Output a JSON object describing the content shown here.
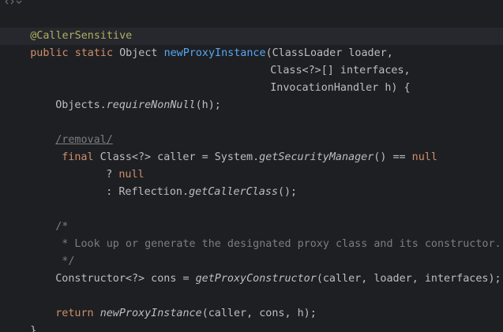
{
  "code": {
    "l1": {
      "annotation": "@CallerSensitive"
    },
    "l2": {
      "public": "public",
      "static": "static",
      "type": "Object",
      "method": "newProxyInstance",
      "params": "(ClassLoader loader,"
    },
    "l3": {
      "text": "Class<?>[] interfaces,"
    },
    "l4": {
      "text": "InvocationHandler h) {"
    },
    "l5": {
      "pre": "Objects.",
      "call": "requireNonNull",
      "post": "(h);"
    },
    "l6": {
      "marker": "/removal/"
    },
    "l7": {
      "final": "final",
      "mid": " Class<?> caller = System.",
      "call": "getSecurityManager",
      "mid2": "() == ",
      "null": "null"
    },
    "l8": {
      "q": "? ",
      "null": "null"
    },
    "l9": {
      "pre": ": Reflection.",
      "call": "getCallerClass",
      "post": "();"
    },
    "l10": {
      "text": "/*"
    },
    "l11": {
      "text": " * Look up or generate the designated proxy class and its constructor."
    },
    "l12": {
      "text": " */"
    },
    "l13": {
      "pre": "Constructor<?> cons = ",
      "call": "getProxyConstructor",
      "post": "(caller, loader, interfaces);"
    },
    "l14": {
      "return": "return",
      "call": "newProxyInstance",
      "post": "(caller, cons, h);"
    },
    "l15": {
      "text": "}"
    }
  },
  "colors": {
    "background": "#1e1f22",
    "keyword": "#cf8e6d",
    "annotation": "#b3ae60",
    "method_declaration": "#56a8f5",
    "comment": "#7a7e85",
    "text": "#bcbec4"
  },
  "icons": [
    "code-vision-icon",
    "chevron-down-icon"
  ]
}
